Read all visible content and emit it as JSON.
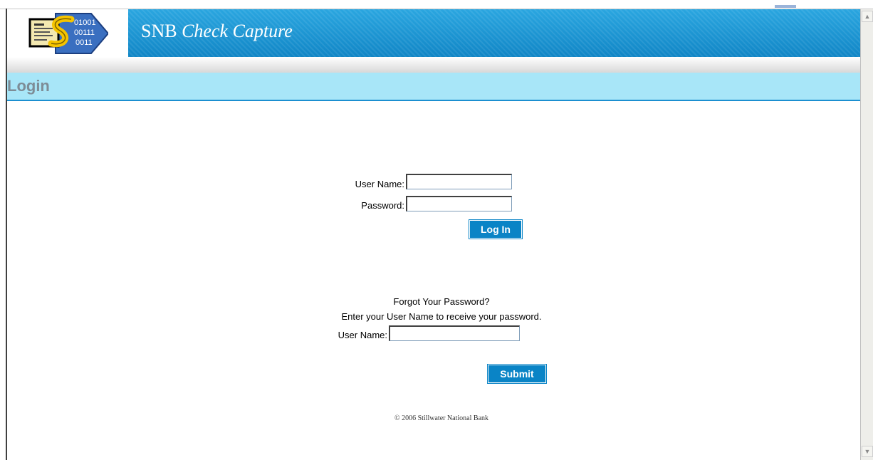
{
  "header": {
    "brand": "SNB",
    "title_italic": "Check Capture",
    "logo_digits": [
      "01001",
      "00111",
      "0011"
    ]
  },
  "page_title": "Login",
  "login_form": {
    "username_label": "User Name:",
    "username_value": "",
    "password_label": "Password:",
    "password_value": "",
    "login_button": "Log In"
  },
  "forgot_form": {
    "heading": "Forgot Your Password?",
    "instructions": "Enter your User Name to receive your password.",
    "username_label": "User Name:",
    "username_value": "",
    "submit_button": "Submit"
  },
  "footer": {
    "copyright": "© 2006 Stillwater National Bank"
  },
  "colors": {
    "header_blue": "#1a96d6",
    "band_cyan": "#a8e6f8",
    "button_blue": "#0a84c6",
    "login_title_gray": "#7d8c96"
  }
}
